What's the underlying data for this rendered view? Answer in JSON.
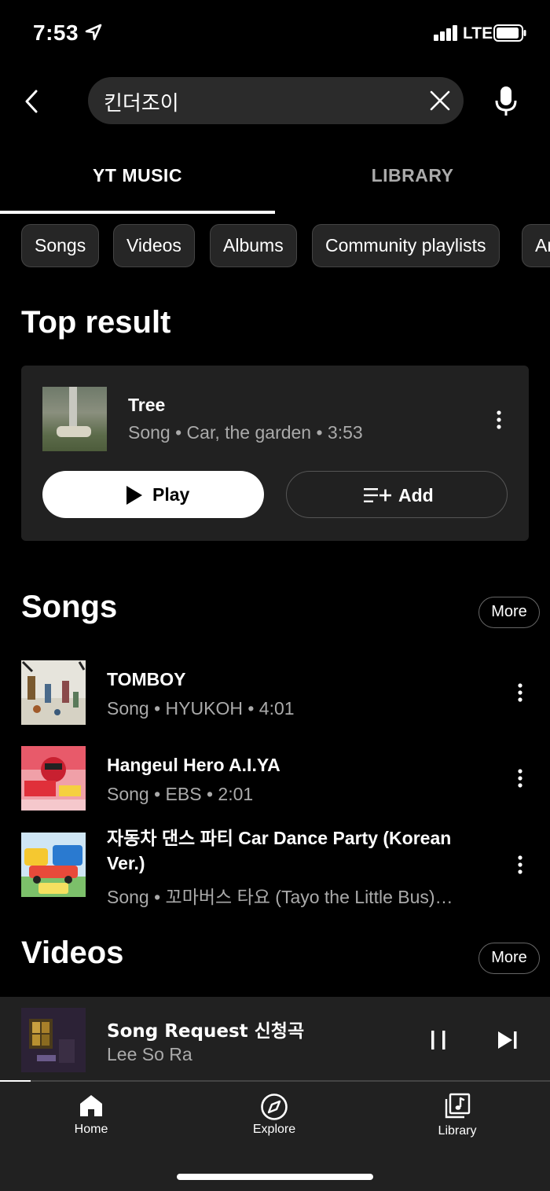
{
  "status_bar": {
    "time": "7:53",
    "network": "LTE"
  },
  "search": {
    "query": "킨더조이"
  },
  "tabs": [
    {
      "label": "YT MUSIC",
      "active": true
    },
    {
      "label": "LIBRARY",
      "active": false
    }
  ],
  "chips": [
    "Songs",
    "Videos",
    "Albums",
    "Community playlists",
    "Ar"
  ],
  "top_result": {
    "heading": "Top result",
    "title": "Tree",
    "subtitle": "Song • Car, the garden • 3:53",
    "play_label": "Play",
    "add_label": "Add"
  },
  "songs": {
    "heading": "Songs",
    "more_label": "More",
    "items": [
      {
        "title": "TOMBOY",
        "subtitle": "Song • HYUKOH • 4:01"
      },
      {
        "title": "Hangeul Hero A.I.YA",
        "subtitle": "Song • EBS • 2:01"
      },
      {
        "title": "자동차 댄스 파티   Car Dance Party (Korean Ver.)",
        "subtitle": "Song • 꼬마버스 타요 (Tayo the Little Bus)…"
      }
    ]
  },
  "videos": {
    "heading": "Videos",
    "more_label": "More"
  },
  "now_playing": {
    "title": "Song Request 신청곡",
    "artist": "Lee So Ra",
    "progress": 0.055
  },
  "bottom_nav": [
    {
      "label": "Home",
      "icon": "home-icon"
    },
    {
      "label": "Explore",
      "icon": "compass-icon"
    },
    {
      "label": "Library",
      "icon": "library-icon"
    }
  ],
  "colors": {
    "background": "#000000",
    "surface": "#212121",
    "secondary_text": "#aaaaaa",
    "accent": "#ffffff"
  }
}
